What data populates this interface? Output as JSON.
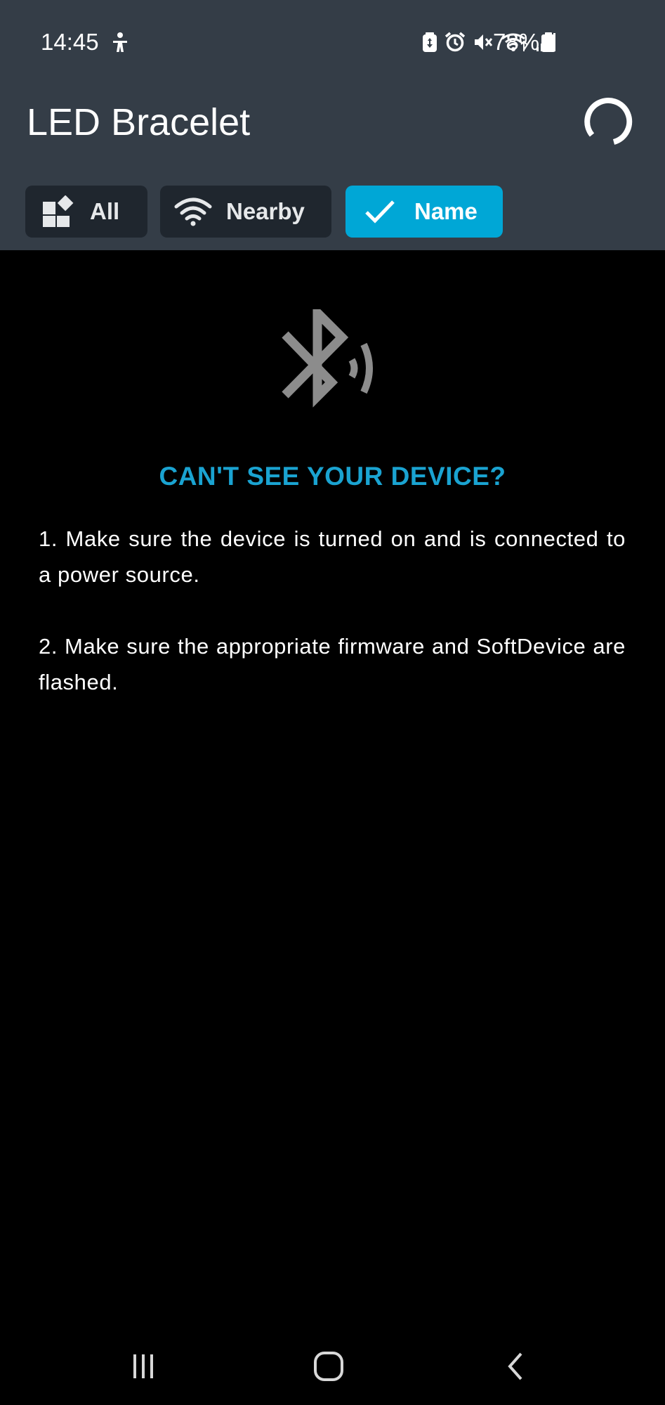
{
  "status_bar": {
    "time": "14:45",
    "battery_percent": "78%",
    "icons": [
      "accessibility-icon",
      "battery-saver-icon",
      "alarm-icon",
      "mute-icon",
      "wifi-icon",
      "signal-icon",
      "battery-icon"
    ]
  },
  "app_bar": {
    "title": "LED Bracelet",
    "scanning_indicator": "spinner-icon"
  },
  "filters": {
    "chips": [
      {
        "label": "All",
        "icon": "dashboard-icon",
        "selected": false
      },
      {
        "label": "Nearby",
        "icon": "wifi-icon",
        "selected": false
      },
      {
        "label": "Name",
        "icon": "check-icon",
        "selected": true
      }
    ]
  },
  "empty_state": {
    "icon": "bluetooth-searching-icon",
    "heading": "CAN'T SEE YOUR DEVICE?",
    "steps": [
      "1. Make sure the device is turned on and is connected to a power source.",
      "2. Make sure the appropriate firmware and SoftDevice are flashed."
    ]
  },
  "navigation_bar": {
    "buttons": [
      "recents-icon",
      "home-icon",
      "back-icon"
    ]
  },
  "colors": {
    "header_background": "#343d47",
    "chip_background": "#1f262e",
    "chip_selected": "#00a7d6",
    "heading_accent": "#1aa3d1",
    "screen_background": "#000000"
  }
}
